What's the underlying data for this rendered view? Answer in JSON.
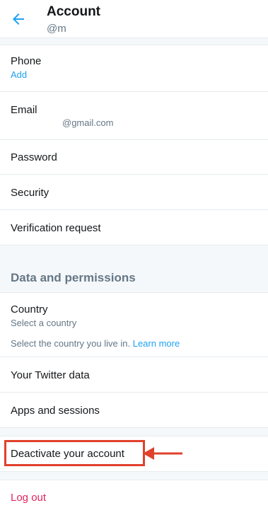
{
  "header": {
    "back_icon": "arrow-left-icon",
    "title": "Account",
    "handle": "@m"
  },
  "rows": {
    "phone": {
      "label": "Phone",
      "value": "Add"
    },
    "email": {
      "label": "Email",
      "value": "@gmail.com"
    },
    "password": {
      "label": "Password"
    },
    "security": {
      "label": "Security"
    },
    "verification": {
      "label": "Verification request"
    }
  },
  "data_permissions": {
    "title": "Data and permissions",
    "country_label": "Country",
    "country_value": "Select a country",
    "country_note": "Select the country you live in.",
    "learn_more": "Learn more",
    "twitter_data": "Your Twitter data",
    "apps_sessions": "Apps and sessions"
  },
  "deactivate": {
    "label": "Deactivate your account"
  },
  "logout": {
    "label": "Log out"
  },
  "colors": {
    "accent": "#1da1f2",
    "danger": "#e0245e",
    "annotation": "#e0412c"
  }
}
